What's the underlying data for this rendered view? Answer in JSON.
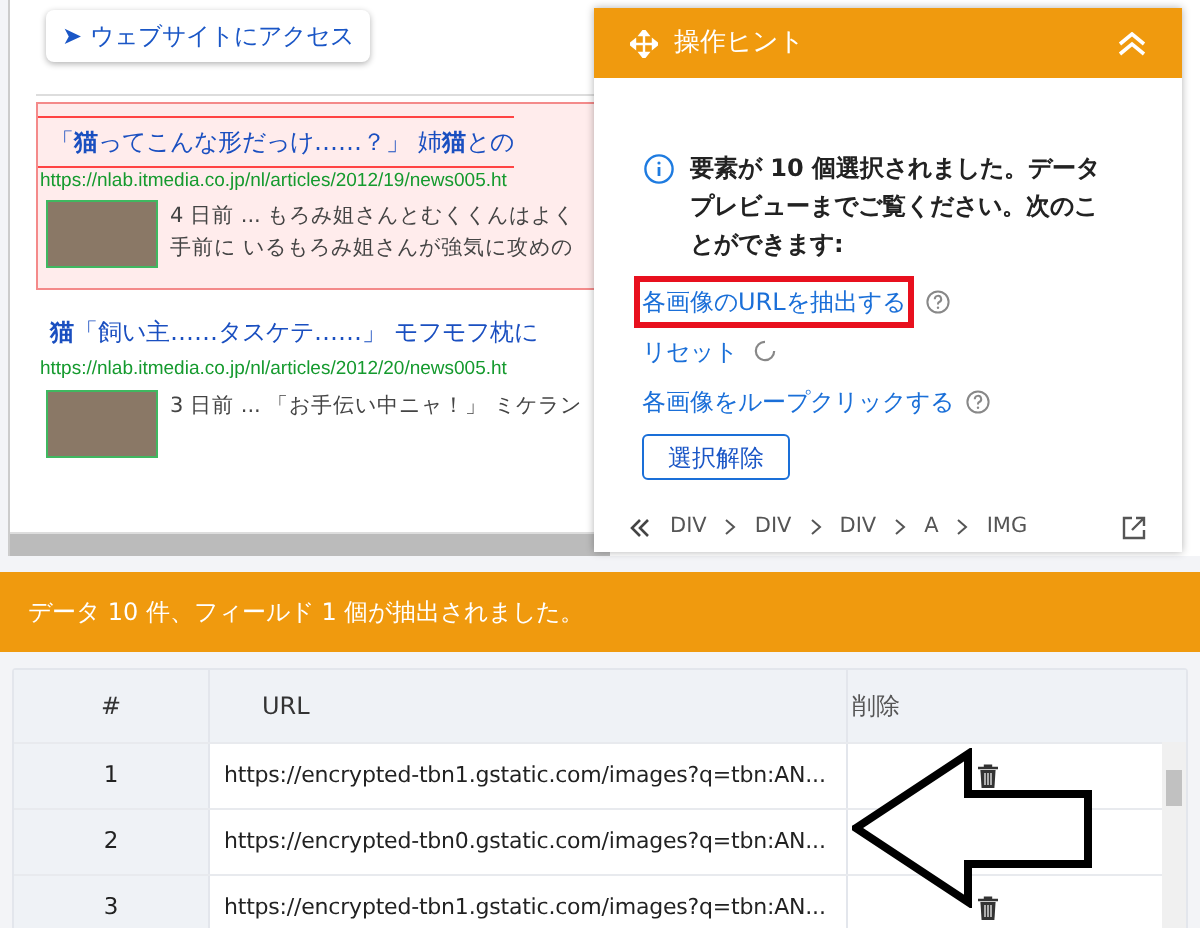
{
  "page": {
    "access_button": "➤ ウェブサイトにアクセス",
    "results": [
      {
        "title": "「**猫**ってこんな形だっけ……？」 姉**猫**との",
        "url": "https://nlab.itmedia.co.jp/nl/articles/2012/19/news005.ht",
        "snippet": [
          "4 日前 ... もろみ姐さんとむくくんはよく",
          "手前に いるもろみ姐さんが強気に攻めの"
        ],
        "highlighted": true
      },
      {
        "title": "**猫**「飼い主……タスケテ……」 モフモフ枕に",
        "url": "https://nlab.itmedia.co.jp/nl/articles/2012/20/news005.ht",
        "snippet": [
          "3 日前 ... 「お手伝い中ニャ！」 ミケラン"
        ],
        "highlighted": false
      }
    ]
  },
  "hint_panel": {
    "title": "操作ヒント",
    "message": "要素が 10 個選択されました。データプレビューまでご覧ください。次のことができます:",
    "actions": [
      {
        "label": "各画像のURLを抽出する",
        "kind": "help",
        "highlighted": true
      },
      {
        "label": "リセット",
        "kind": "reset",
        "highlighted": false
      },
      {
        "label": "各画像をループクリックする",
        "kind": "help",
        "highlighted": false
      }
    ],
    "deselect_button": "選択解除",
    "breadcrumb": [
      "DIV",
      "DIV",
      "DIV",
      "A",
      "IMG"
    ]
  },
  "status_bar": "データ 10 件、フィールド 1 個が抽出されました。",
  "table": {
    "columns": [
      "#",
      "URL",
      "削除"
    ],
    "rows": [
      {
        "index": "1",
        "url": "https://encrypted-tbn1.gstatic.com/images?q=tbn:AN..."
      },
      {
        "index": "2",
        "url": "https://encrypted-tbn0.gstatic.com/images?q=tbn:AN..."
      },
      {
        "index": "3",
        "url": "https://encrypted-tbn1.gstatic.com/images?q=tbn:AN..."
      }
    ]
  }
}
